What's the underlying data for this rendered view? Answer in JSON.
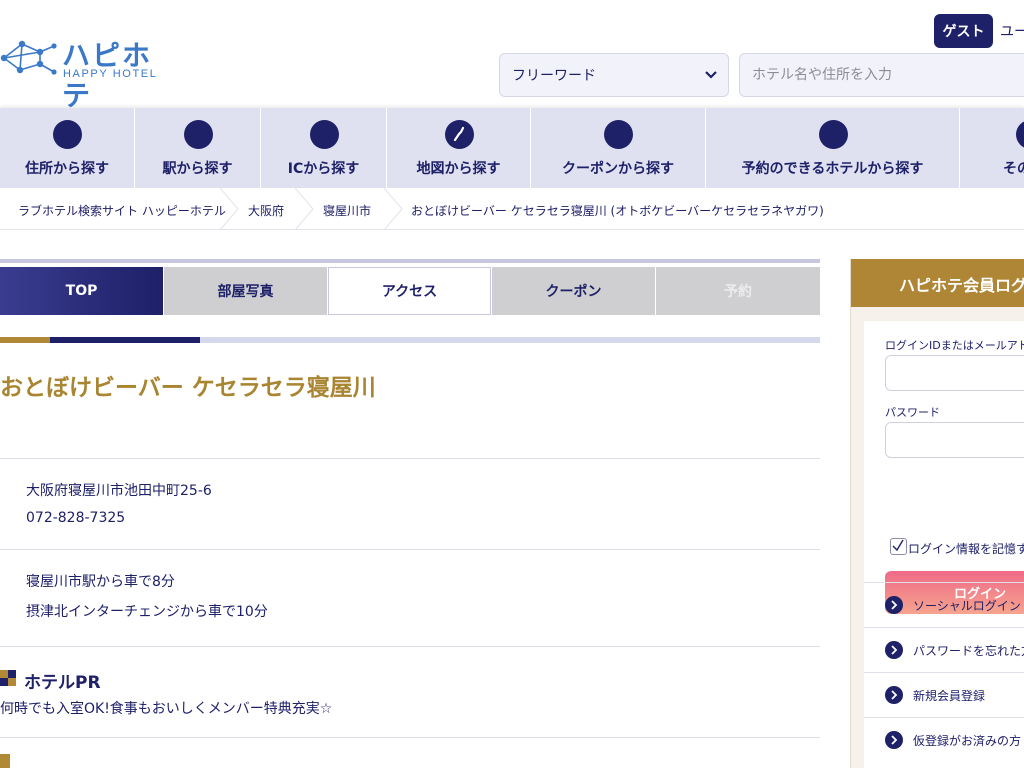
{
  "header": {
    "logo_text": "ハピホテ",
    "logo_sub": "HAPPY HOTEL",
    "guest_label": "ゲスト",
    "user_label": "ユー"
  },
  "search": {
    "select_value": "フリーワード",
    "placeholder": "ホテル名や住所を入力"
  },
  "nav": [
    {
      "label": "住所から探す",
      "icon": "location-icon"
    },
    {
      "label": "駅から探す",
      "icon": "station-icon"
    },
    {
      "label": "ICから探す",
      "icon": "highway-icon"
    },
    {
      "label": "地図から探す",
      "icon": "map-icon"
    },
    {
      "label": "クーポンから探す",
      "icon": "coupon-icon"
    },
    {
      "label": "予約のできるホテルから探す",
      "icon": "reservation-icon"
    },
    {
      "label": "その他",
      "icon": "more-icon"
    }
  ],
  "breadcrumb": [
    "ラブホテル検索サイト ハッピーホテル",
    "大阪府",
    "寝屋川市",
    "おとぼけビーバー ケセラセラ寝屋川 (オトボケビーバーケセラセラネヤガワ)"
  ],
  "tabs": {
    "top": "TOP",
    "photos": "部屋写真",
    "access": "アクセス",
    "coupon": "クーポン",
    "reserve": "予約"
  },
  "hotel": {
    "name": "おとぼけビーバー ケセラセラ寝屋川",
    "address": "大阪府寝屋川市池田中町25-6",
    "phone": "072-828-7325",
    "access_1": "寝屋川市駅から車で8分",
    "access_2": "摂津北インターチェンジから車で10分",
    "pr_title": "ホテルPR",
    "pr_text": "何時でも入室OK!食事もおいしくメンバー特典充実☆"
  },
  "login": {
    "title": "ハピホテ会員ログ",
    "id_label": "ログインIDまたはメールアドレ",
    "password_label": "パスワード",
    "remember_label": "ログイン情報を記憶す",
    "button_label": "ログイン",
    "links": [
      "ソーシャルログイン",
      "パスワードを忘れた方",
      "新規会員登録",
      "仮登録がお済みの方"
    ]
  },
  "colors": {
    "navy": "#1e2068",
    "gold": "#ae8636",
    "nav_bg": "#dfe0f0",
    "login_gradient_start": "#f06a87",
    "login_gradient_end": "#f5a48e"
  }
}
